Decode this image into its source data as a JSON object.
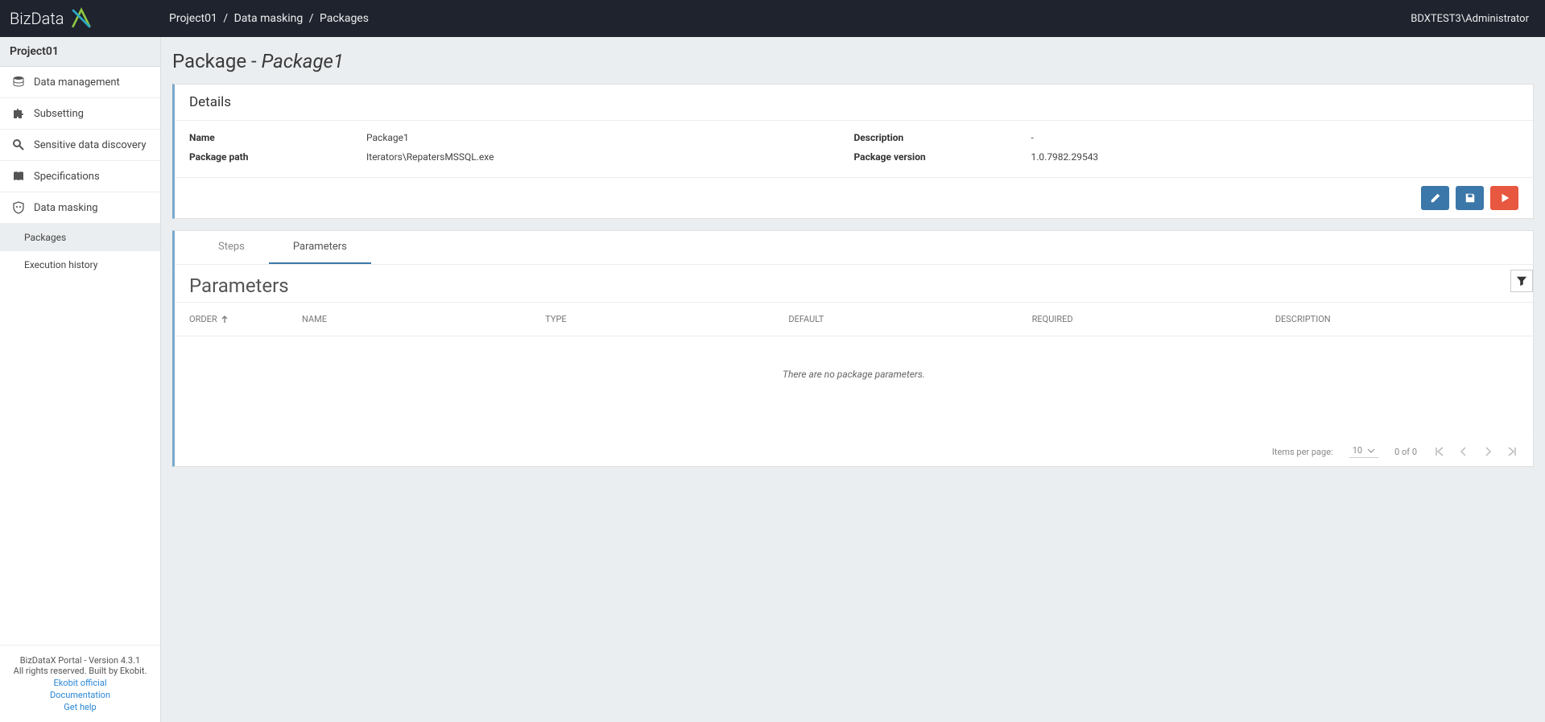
{
  "logo_text": "BizData",
  "breadcrumb": [
    "Project01",
    "Data masking",
    "Packages"
  ],
  "user": "BDXTEST3\\Administrator",
  "sidebar": {
    "project": "Project01",
    "items": [
      {
        "label": "Data management"
      },
      {
        "label": "Subsetting"
      },
      {
        "label": "Sensitive data discovery"
      },
      {
        "label": "Specifications"
      },
      {
        "label": "Data masking"
      }
    ],
    "sub": [
      {
        "label": "Packages",
        "active": true
      },
      {
        "label": "Execution history",
        "active": false
      }
    ],
    "footer": {
      "line1": "BizDataX Portal - Version 4.3.1",
      "line2": "All rights reserved. Built by Ekobit.",
      "links": [
        "Ekobit official",
        "Documentation",
        "Get help"
      ]
    }
  },
  "page_title_prefix": "Package - ",
  "page_title_name": "Package1",
  "details": {
    "header": "Details",
    "labels": {
      "name": "Name",
      "desc": "Description",
      "path": "Package path",
      "ver": "Package version"
    },
    "values": {
      "name": "Package1",
      "desc": "-",
      "path": "Iterators\\RepatersMSSQL.exe",
      "ver": "1.0.7982.29543"
    }
  },
  "tabs": {
    "steps": "Steps",
    "parameters": "Parameters",
    "active": "parameters"
  },
  "parameters": {
    "title": "Parameters",
    "columns": [
      "ORDER",
      "NAME",
      "TYPE",
      "DEFAULT",
      "REQUIRED",
      "DESCRIPTION"
    ],
    "empty": "There are no package parameters.",
    "paginator": {
      "label": "Items per page:",
      "per_page": "10",
      "range": "0 of 0"
    }
  }
}
